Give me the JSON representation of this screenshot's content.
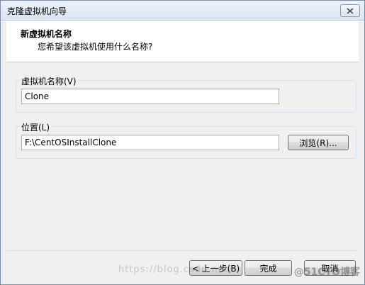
{
  "window": {
    "title": "克隆虚拟机向导"
  },
  "header": {
    "title": "新虚拟机名称",
    "subtitle": "您希望该虚拟机使用什么名称?"
  },
  "name_group": {
    "label": "虚拟机名称(V)",
    "value": "Clone"
  },
  "location_group": {
    "label": "位置(L)",
    "value": "F:\\CentOSInstallClone",
    "browse_label": "浏览(R)..."
  },
  "footer": {
    "back_label": "< 上一步(B)",
    "finish_label": "完成",
    "cancel_label": "取消"
  },
  "watermark": {
    "url_text": "https://blog.csdn.net/",
    "logo_text": "@51CTO博客"
  },
  "icons": {
    "close": "close-icon"
  }
}
